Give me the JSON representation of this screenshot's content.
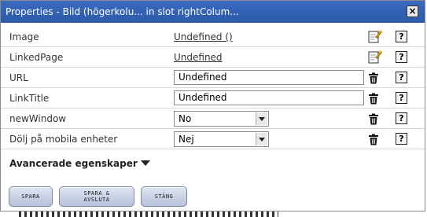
{
  "window": {
    "title": "Properties - Bild (högerkolu... in slot rightColum...",
    "close_label": "×"
  },
  "properties": [
    {
      "label": "Image",
      "type": "link",
      "value": "Undefined ()",
      "icon": "edit-icon"
    },
    {
      "label": "LinkedPage",
      "type": "link",
      "value": "Undefined",
      "icon": "edit-icon"
    },
    {
      "label": "URL",
      "type": "text",
      "value": "Undefined",
      "icon": "trash-icon"
    },
    {
      "label": "LinkTitle",
      "type": "text",
      "value": "Undefined",
      "icon": "trash-icon"
    },
    {
      "label": "newWindow",
      "type": "select",
      "value": "No",
      "icon": "trash-icon"
    },
    {
      "label": "Dölj på mobila enheter",
      "type": "select",
      "value": "Nej",
      "icon": "trash-icon"
    }
  ],
  "help_label": "?",
  "advanced": {
    "label": "Avancerade egenskaper"
  },
  "buttons": {
    "save": "SPARA",
    "save_close_line1": "SPARA &",
    "save_close_line2": "AVSLUTA",
    "close": "STÄNG"
  }
}
